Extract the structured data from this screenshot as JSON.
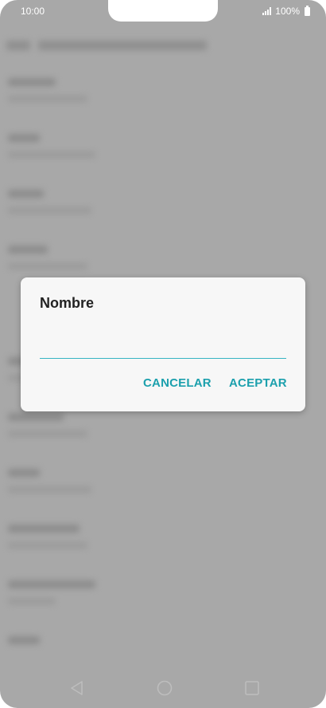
{
  "status_bar": {
    "time": "10:00",
    "battery": "100%"
  },
  "dialog": {
    "title": "Nombre",
    "input_value": "",
    "input_placeholder": "",
    "cancel_label": "CANCELAR",
    "accept_label": "ACEPTAR"
  },
  "navigation": {
    "back_icon": "back-triangle",
    "home_icon": "home-circle",
    "recent_icon": "recent-square"
  },
  "colors": {
    "accent": "#1ca0ad",
    "underline": "#36b4c2",
    "scrim": "#a8a8a8",
    "dialog_bg": "#f7f7f7"
  }
}
